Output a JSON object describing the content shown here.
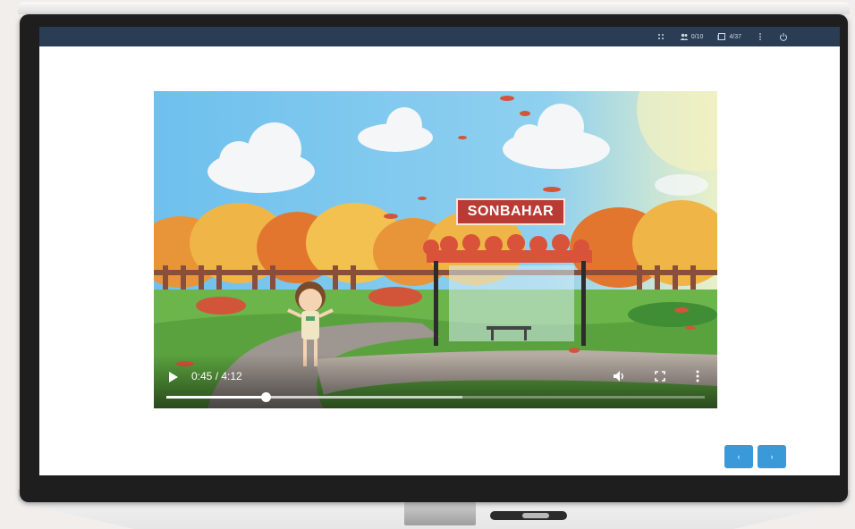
{
  "topbar": {
    "participants": "0/10",
    "pages": "4/37",
    "icons": [
      "drag-icon",
      "people-icon",
      "pages-icon",
      "more-vertical-icon",
      "power-icon"
    ]
  },
  "video": {
    "sign_text": "SONBAHAR",
    "time": "0:45 / 4:12",
    "progress": 0.185,
    "buffered": 0.55
  },
  "nav": {
    "prev_label": "‹",
    "next_label": "›"
  },
  "colors": {
    "topbar": "#2a3d54",
    "nav_button": "#3a9ad9",
    "sign": "#b83b35"
  }
}
